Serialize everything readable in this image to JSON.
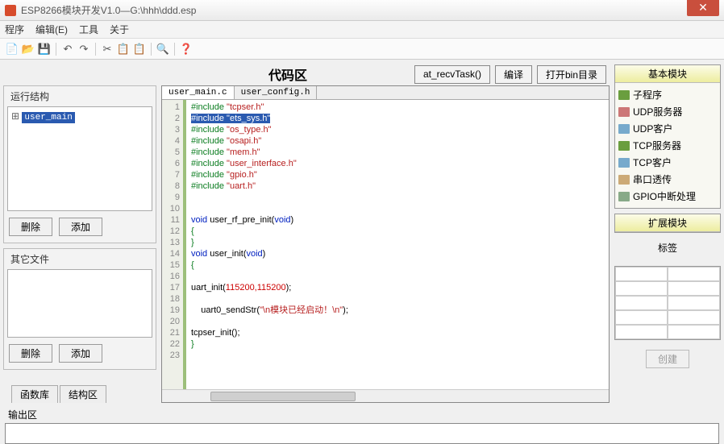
{
  "window": {
    "title": "ESP8266模块开发V1.0—G:\\hhh\\ddd.esp"
  },
  "menu": {
    "program": "程序",
    "edit": "编辑(E)",
    "tools": "工具",
    "about": "关于"
  },
  "left": {
    "struct_title": "运行结构",
    "tree_root": "user_main",
    "delete": "删除",
    "add": "添加",
    "other_title": "其它文件",
    "tab_funclib": "函数库",
    "tab_struct": "结构区"
  },
  "center": {
    "title": "代码区",
    "btn_recv": "at_recvTask()",
    "btn_compile": "编译",
    "btn_open": "打开bin目录",
    "tabs": [
      "user_main.c",
      "user_config.h"
    ],
    "lines": [
      "1",
      "2",
      "3",
      "4",
      "5",
      "6",
      "7",
      "8",
      "9",
      "10",
      "11",
      "12",
      "13",
      "14",
      "15",
      "16",
      "17",
      "18",
      "19",
      "20",
      "21",
      "22",
      "23"
    ]
  },
  "code": {
    "l1a": "#include ",
    "l1b": "\"tcpser.h\"",
    "l2a": "#include ",
    "l2b": "\"ets_sys.h\"",
    "l3a": "#include ",
    "l3b": "\"os_type.h\"",
    "l4a": "#include ",
    "l4b": "\"osapi.h\"",
    "l5a": "#include ",
    "l5b": "\"mem.h\"",
    "l6a": "#include ",
    "l6b": "\"user_interface.h\"",
    "l7a": "#include ",
    "l7b": "\"gpio.h\"",
    "l8a": "#include ",
    "l8b": "\"uart.h\"",
    "l11a": "void",
    "l11b": " user_rf_pre_init(",
    "l11c": "void",
    "l11d": ")",
    "l12": "{",
    "l13": "}",
    "l14a": "void",
    "l14b": " user_init(",
    "l14c": "void",
    "l14d": ")",
    "l15": "{",
    "l17a": "uart_init(",
    "l17b": "115200,115200",
    "l17c": ");",
    "l19a": "    uart0_sendStr(",
    "l19b": "\"\\n模块已经启动！\\n\"",
    "l19c": ");",
    "l21": "tcpser_init();",
    "l22": "}"
  },
  "right": {
    "basic": "基本模块",
    "items": [
      "子程序",
      "UDP服务器",
      "UDP客户",
      "TCP服务器",
      "TCP客户",
      "串口透传",
      "GPIO中断处理"
    ],
    "ext": "扩展模块",
    "label": "标签",
    "create": "创建"
  },
  "output": {
    "title": "输出区"
  }
}
